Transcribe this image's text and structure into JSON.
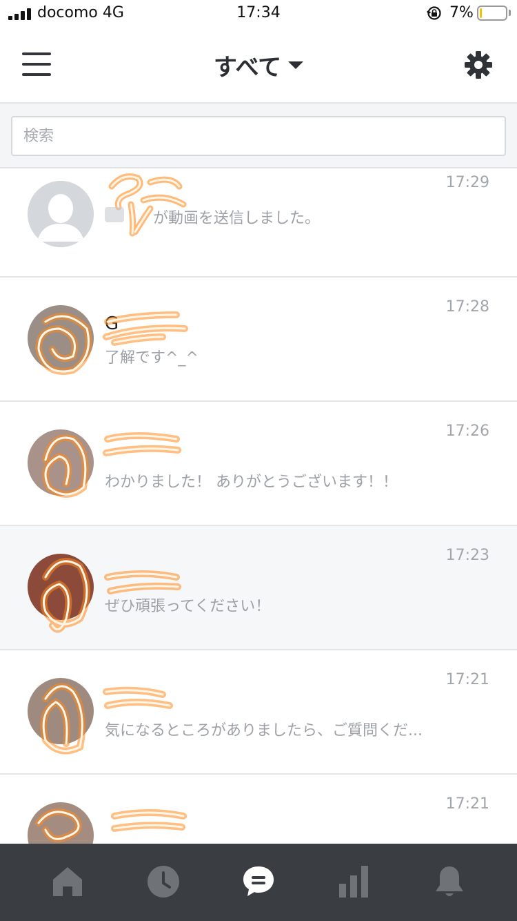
{
  "status_bar": {
    "carrier": "docomo  4G",
    "time": "17:34",
    "battery_percent": "7%",
    "battery_level": 0.07,
    "signal_icon": "signal-bars-icon",
    "lock_icon": "rotation-lock-icon",
    "battery_icon": "battery-icon"
  },
  "header": {
    "title": "すべて",
    "menu_icon": "hamburger-menu-icon",
    "dropdown_icon": "caret-down-icon",
    "settings_icon": "gear-icon"
  },
  "search": {
    "placeholder": "検索",
    "value": ""
  },
  "chats": [
    {
      "time": "17:29",
      "name": "",
      "preview": "が動画を送信しました。",
      "avatar": "default-person-icon",
      "selected": false
    },
    {
      "time": "17:28",
      "name": "G",
      "preview": "了解です^_^",
      "avatar": "redacted-photo",
      "selected": false
    },
    {
      "time": "17:26",
      "name": "",
      "preview": "わかりました！ ありがとうございます！！",
      "avatar": "redacted-photo",
      "selected": false
    },
    {
      "time": "17:23",
      "name": "",
      "preview": "ぜひ頑張ってください！",
      "avatar": "redacted-photo",
      "selected": true
    },
    {
      "time": "17:21",
      "name": "",
      "preview": "気になるところがありましたら、ご質問くだ...",
      "avatar": "redacted-photo",
      "selected": false
    },
    {
      "time": "17:21",
      "name": "",
      "preview": "",
      "avatar": "redacted-photo",
      "selected": false
    }
  ],
  "tabbar": {
    "tabs": [
      {
        "icon": "home-icon",
        "active": false
      },
      {
        "icon": "clock-icon",
        "active": false
      },
      {
        "icon": "chat-bubble-icon",
        "active": true
      },
      {
        "icon": "bar-chart-icon",
        "active": false
      },
      {
        "icon": "bell-icon",
        "active": false
      }
    ],
    "active_color": "#ffffff",
    "inactive_color": "#6f7378",
    "background": "#3a3d42"
  },
  "colors": {
    "scribble_orange": "#ff8a1e",
    "scribble_core": "#ffffff"
  }
}
